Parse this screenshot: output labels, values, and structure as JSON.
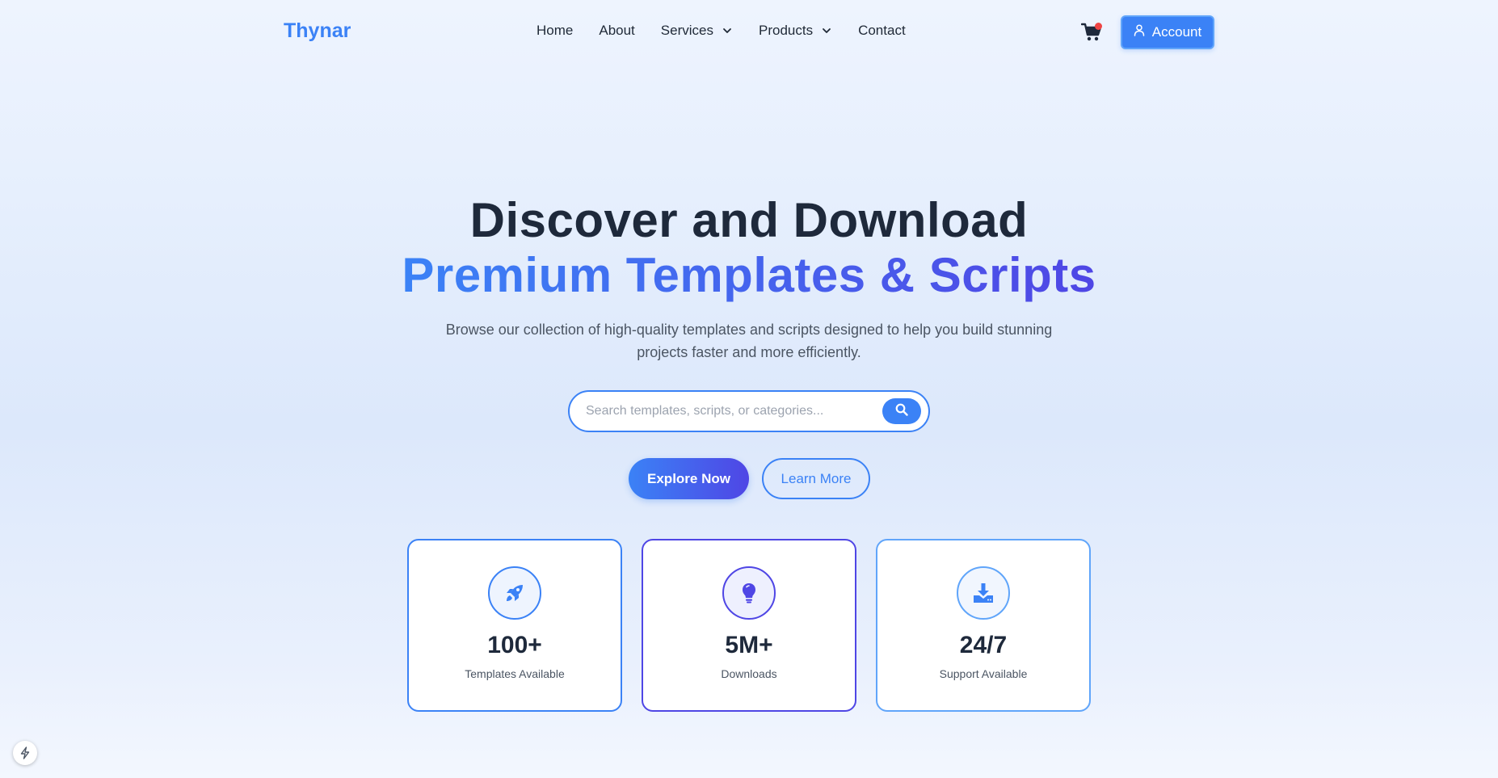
{
  "header": {
    "logo": "Thynar",
    "nav": [
      {
        "label": "Home",
        "dropdown": false
      },
      {
        "label": "About",
        "dropdown": false
      },
      {
        "label": "Services",
        "dropdown": true
      },
      {
        "label": "Products",
        "dropdown": true
      },
      {
        "label": "Contact",
        "dropdown": false
      }
    ],
    "cart_icon": "shopping-cart-icon",
    "account_label": "Account"
  },
  "hero": {
    "title_line1": "Discover and Download",
    "title_line2": "Premium Templates & Scripts",
    "subtitle": "Browse our collection of high-quality templates and scripts designed to help you build stunning projects faster and more efficiently."
  },
  "search": {
    "placeholder": "Search templates, scripts, or categories...",
    "value": ""
  },
  "cta": {
    "primary": "Explore Now",
    "secondary": "Learn More"
  },
  "stats": [
    {
      "icon": "rocket-icon",
      "value": "100+",
      "label": "Templates Available"
    },
    {
      "icon": "lightbulb-icon",
      "value": "5M+",
      "label": "Downloads"
    },
    {
      "icon": "download-icon",
      "value": "24/7",
      "label": "Support Available"
    }
  ],
  "colors": {
    "primary": "#3b82f6",
    "accent": "#4f46e5",
    "text": "#1e293b",
    "cart_badge": "#ef4444"
  }
}
